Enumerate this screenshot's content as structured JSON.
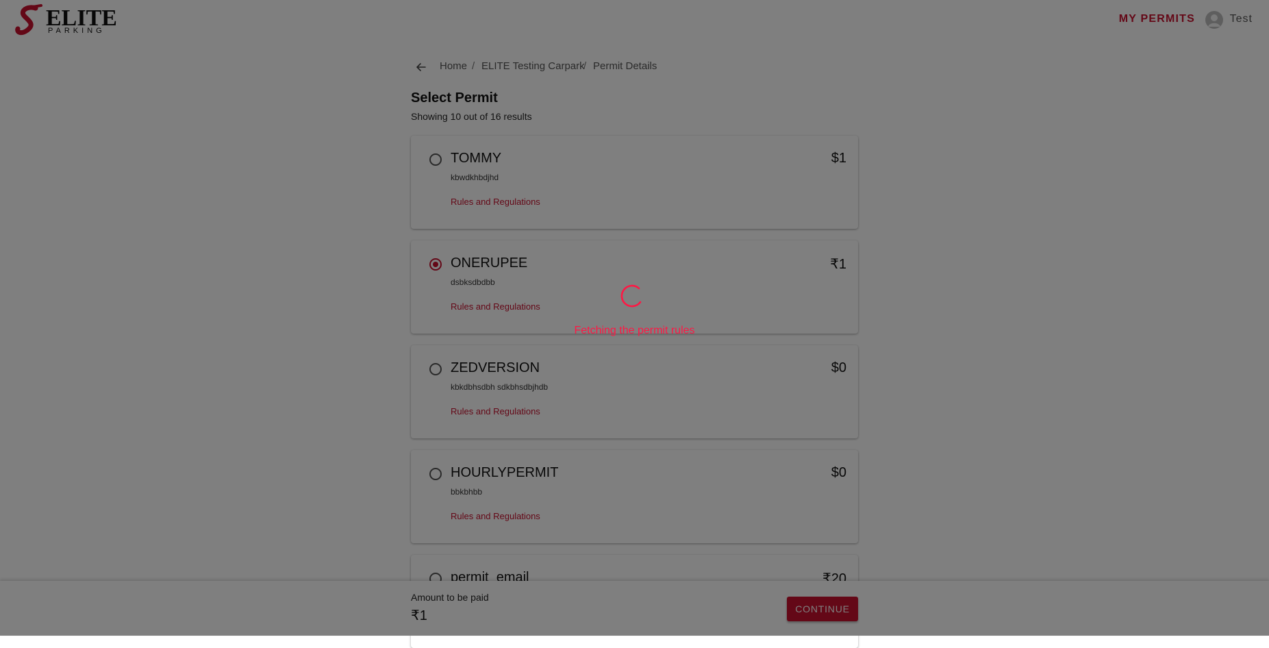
{
  "header": {
    "logo_text": "ELITE",
    "logo_subtext": "PARKING",
    "nav_permits": "MY PERMITS",
    "user_name": "Test"
  },
  "breadcrumb": {
    "items": [
      "Home",
      "ELITE Testing Carpark",
      "Permit Details"
    ],
    "separator": "/"
  },
  "page": {
    "title": "Select Permit",
    "results_text": "Showing 10 out of 16 results"
  },
  "permits": [
    {
      "name": "TOMMY",
      "price": "$1",
      "description": "kbwdkhbdjhd",
      "rules_link": "Rules and Regulations",
      "selected": false
    },
    {
      "name": "ONERUPEE",
      "price": "₹1",
      "description": "dsbksdbdbb",
      "rules_link": "Rules and Regulations",
      "selected": true
    },
    {
      "name": "ZEDVERSION",
      "price": "$0",
      "description": "kbkdbhsdbh sdkbhsdbjhdb",
      "rules_link": "Rules and Regulations",
      "selected": false
    },
    {
      "name": "HOURLYPERMIT",
      "price": "$0",
      "description": "bbkbhbb",
      "rules_link": "Rules and Regulations",
      "selected": false
    },
    {
      "name": "permit_email",
      "price": "₹20",
      "description": "",
      "rules_link": "",
      "selected": false
    }
  ],
  "loading": {
    "message": "Fetching the permit rules"
  },
  "footer": {
    "amount_label": "Amount to be paid",
    "amount_value": "₹1",
    "continue_label": "CONTINUE"
  },
  "colors": {
    "accent": "#c8102e",
    "loader": "#ff1744",
    "overlay": "rgba(0,0,0,0.5)"
  }
}
